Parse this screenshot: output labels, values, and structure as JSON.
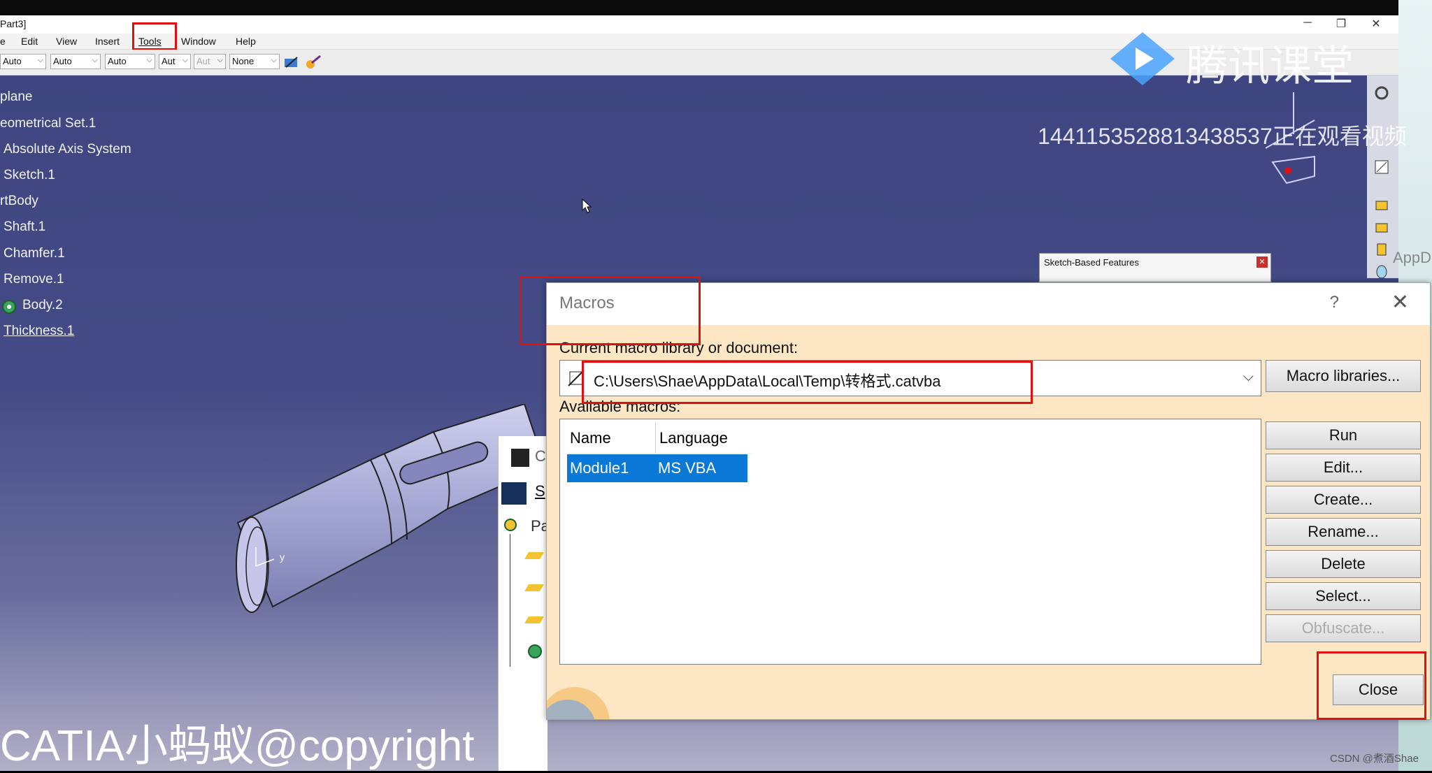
{
  "window": {
    "title": "Part3]",
    "controls": [
      "─",
      "❐",
      "✕"
    ]
  },
  "menu": [
    "e",
    "Edit",
    "View",
    "Insert",
    "Tools",
    "Window",
    "Help"
  ],
  "toolbar": {
    "combos": [
      "Auto",
      "Auto",
      "Auto",
      "Aut",
      "Aut",
      "None"
    ]
  },
  "tree": [
    "plane",
    "eometrical Set.1",
    "Absolute Axis System",
    "Sketch.1",
    "rtBody",
    "Shaft.1",
    "Chamfer.1",
    "Remove.1",
    "Body.2",
    "Thickness.1"
  ],
  "axis": {
    "y": "y"
  },
  "sketch_toolbar": {
    "title": "Sketch-Based Features"
  },
  "right_label": "AppD",
  "bg_window": {
    "item1": "C",
    "item2": "S",
    "item3": "Pa"
  },
  "dialog": {
    "title": "Macros",
    "help": "?",
    "close_x": "✕",
    "current_label": "Current macro library or document:",
    "path": "C:\\Users\\Shae\\AppData\\Local\\Temp\\转格式.catvba",
    "macro_libraries": "Macro libraries...",
    "available_label": "Available macros:",
    "columns": [
      "Name",
      "Language"
    ],
    "rows": [
      {
        "name": "Module1",
        "language": "MS VBA"
      }
    ],
    "buttons": {
      "run": "Run",
      "edit": "Edit...",
      "create": "Create...",
      "rename": "Rename...",
      "delete": "Delete",
      "select": "Select...",
      "obfuscate": "Obfuscate...",
      "close": "Close"
    }
  },
  "watermarks": {
    "tencent": "腾讯课堂",
    "viewer": "1441153528813438537正在观看视频",
    "catia": "CATIA小蚂蚁@copyright",
    "csdn": "CSDN @煮酒Shae"
  },
  "colors": {
    "viewport_top": "#3e4580",
    "dialog_bg": "#fde6c4",
    "selection": "#0a78d7",
    "annotation_red": "#e01010"
  }
}
